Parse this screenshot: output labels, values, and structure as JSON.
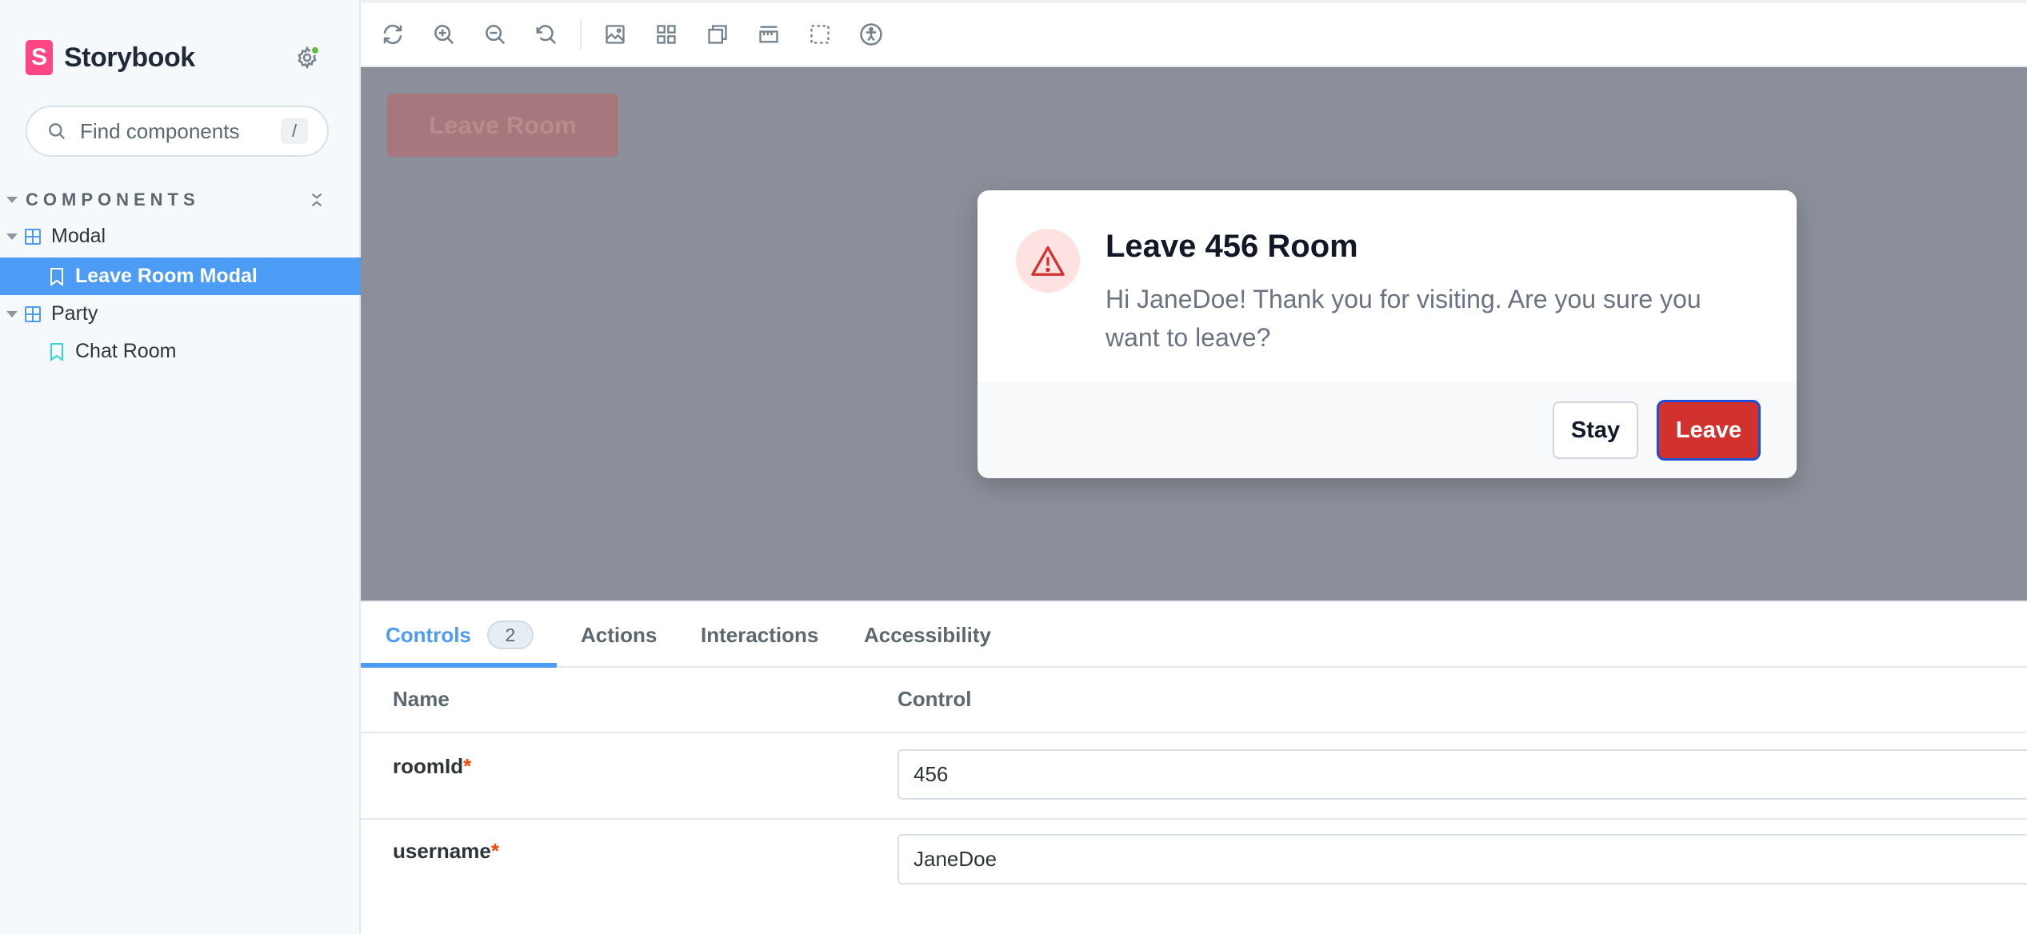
{
  "sidebar": {
    "brand": {
      "logo_letter": "S",
      "name": "Storybook"
    },
    "search": {
      "placeholder": "Find components",
      "shortcut": "/"
    },
    "section_title": "COMPONENTS",
    "tree": [
      {
        "type": "group",
        "label": "Modal"
      },
      {
        "type": "story",
        "label": "Leave Room Modal",
        "selected": true
      },
      {
        "type": "group",
        "label": "Party"
      },
      {
        "type": "story",
        "label": "Chat Room",
        "selected": false
      }
    ]
  },
  "toolbar": {
    "tools": [
      "reload-icon",
      "zoom-in-icon",
      "zoom-out-icon",
      "reset-zoom-icon",
      "background-icon",
      "grid-icon",
      "viewport-icon",
      "measure-icon",
      "outline-icon",
      "accessibility-icon"
    ]
  },
  "canvas": {
    "background_button": "Leave Room",
    "modal": {
      "title": "Leave 456 Room",
      "message": "Hi JaneDoe! Thank you for visiting. Are you sure you want to leave?",
      "stay_label": "Stay",
      "leave_label": "Leave"
    }
  },
  "panel": {
    "tabs": [
      {
        "label": "Controls",
        "badge": "2",
        "active": true
      },
      {
        "label": "Actions"
      },
      {
        "label": "Interactions"
      },
      {
        "label": "Accessibility"
      }
    ],
    "columns": {
      "name": "Name",
      "control": "Control"
    },
    "args": [
      {
        "name": "roomId",
        "required": "*",
        "value": "456"
      },
      {
        "name": "username",
        "required": "*",
        "value": "JaneDoe"
      }
    ]
  },
  "colors": {
    "accent": "#4c9cf5",
    "brand": "#ff4785",
    "danger": "#d2322d",
    "status": "#66bf3c"
  }
}
